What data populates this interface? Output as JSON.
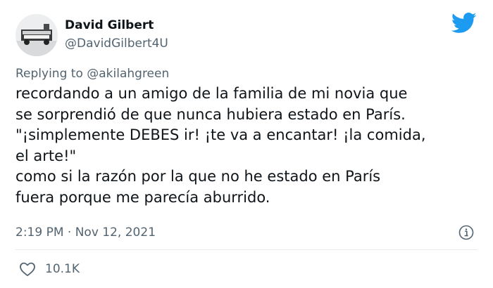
{
  "author": {
    "display_name": "David Gilbert",
    "handle": "@DavidGilbert4U"
  },
  "reply": {
    "prefix": "Replying to",
    "handle": "@akilahgreen"
  },
  "tweet": {
    "lines": [
      "recordando a un amigo de la familia de mi novia que",
      "se sorprendió de que nunca hubiera estado en París.",
      "\"¡simplemente DEBES ir! ¡te va a encantar! ¡la comida,",
      "el arte!\"",
      "como si la razón por la que no he estado en París",
      "fuera porque me parecía aburrido."
    ],
    "time": "2:19 PM",
    "separator": "·",
    "date": "Nov 12, 2021"
  },
  "engagement": {
    "likes": "10.1K"
  },
  "icons": {
    "brand": "twitter-bird-icon",
    "info": "info-icon",
    "like": "heart-icon"
  },
  "colors": {
    "brand_blue": "#1d9bf0",
    "text_primary": "#0f1419",
    "text_secondary": "#536471",
    "divider": "#e6ecf0"
  }
}
